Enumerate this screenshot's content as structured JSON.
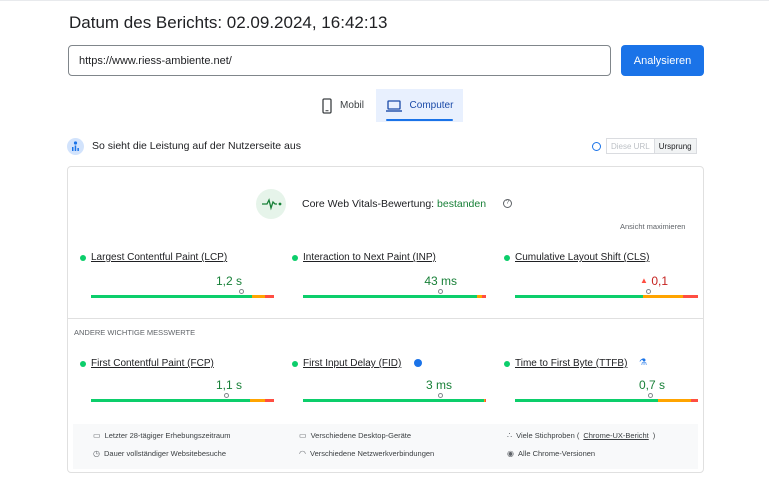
{
  "header": {
    "report_date": "Datum des Berichts: 02.09.2024, 16:42:13"
  },
  "search": {
    "url_value": "https://www.riess-ambiente.net/",
    "analyze_label": "Analysieren"
  },
  "tabs": [
    {
      "label": "Mobil",
      "icon": "phone-icon",
      "selected": false
    },
    {
      "label": "Computer",
      "icon": "laptop-icon",
      "selected": true
    }
  ],
  "section": {
    "title": "So sieht die Leistung auf der Nutzerseite aus",
    "toggle": {
      "this_url": "Diese URL",
      "origin": "Ursprung"
    }
  },
  "cwv": {
    "label": "Core Web Vitals-Bewertung:",
    "status": "bestanden",
    "expand_label": "Ansicht maximieren"
  },
  "core_metrics": [
    {
      "name": "Largest Contentful Paint (LCP)",
      "value": "1,2 s",
      "split": [
        0.88,
        0.07,
        0.05
      ],
      "marker": 0.82
    },
    {
      "name": "Interaction to Next Paint (INP)",
      "value": "43 ms",
      "split": [
        0.95,
        0.03,
        0.02
      ],
      "marker": 0.75
    },
    {
      "name": "Cumulative Layout Shift (CLS)",
      "value": "0,1",
      "split": [
        0.7,
        0.22,
        0.08
      ],
      "marker": 0.73,
      "warning": true
    }
  ],
  "other_heading": "ANDERE WICHTIGE MESSWERTE",
  "other_metrics": [
    {
      "name": "First Contentful Paint (FCP)",
      "value": "1,1 s",
      "split": [
        0.87,
        0.08,
        0.05
      ],
      "marker": 0.74
    },
    {
      "name": "First Input Delay (FID)",
      "value": "3 ms",
      "split": [
        0.99,
        0.005,
        0.005
      ],
      "marker": 0.75,
      "info": true
    },
    {
      "name": "Time to First Byte (TTFB)",
      "value": "0,7 s",
      "split": [
        0.78,
        0.18,
        0.04
      ],
      "marker": 0.74,
      "experimental": true
    }
  ],
  "footer": {
    "collection_period": "Letzter 28-tägiger Erhebungszeitraum",
    "visit_duration": "Dauer vollständiger Websitebesuche",
    "devices": "Verschiedene Desktop-Geräte",
    "connections": "Verschiedene Netzwerkverbindungen",
    "samples_prefix": "Viele Stichproben (",
    "samples_link": "Chrome-UX-Bericht",
    "samples_suffix": ")",
    "chrome_versions": "Alle Chrome-Versionen"
  },
  "colors": {
    "good": "#0cce6b",
    "needs_improvement": "#ffa400",
    "poor": "#ff4e42",
    "accent": "#1a73e8",
    "pass_text": "#188038"
  }
}
